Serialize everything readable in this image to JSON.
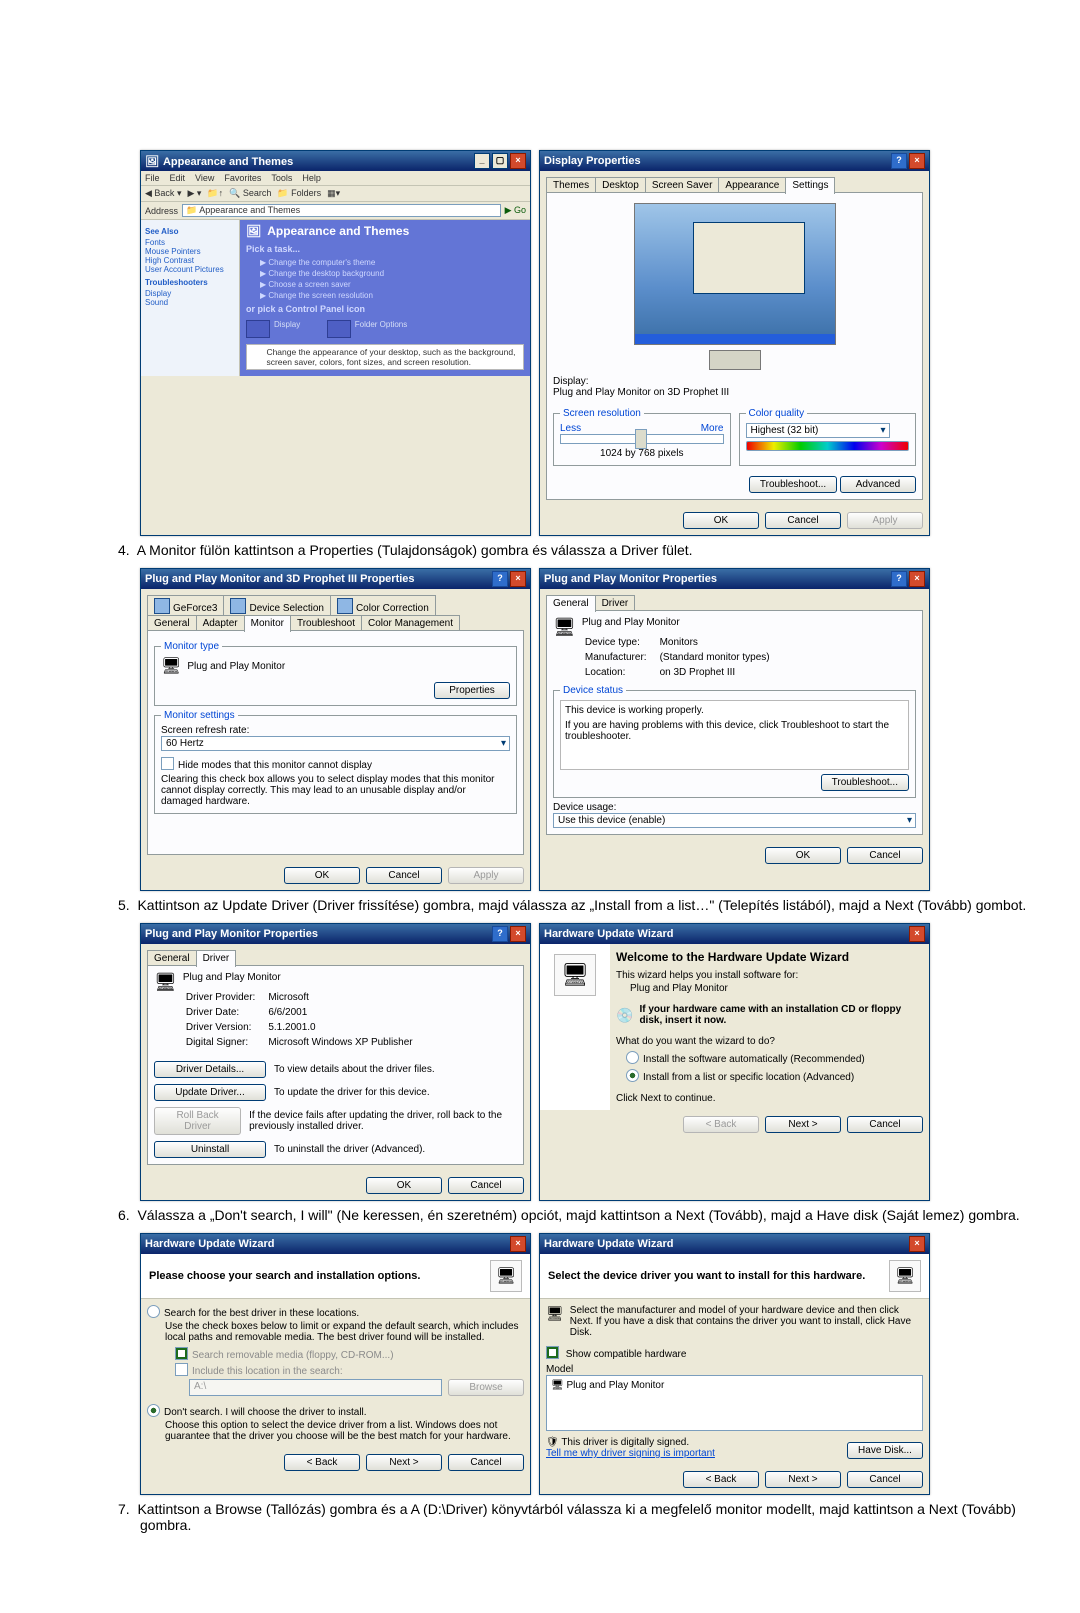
{
  "step4": {
    "num": "4.",
    "text": "A Monitor fülön kattintson a Properties (Tulajdonságok) gombra és válassza a Driver fület."
  },
  "step5": {
    "num": "5.",
    "text": "Kattintson az Update Driver (Driver frissítése) gombra, majd válassza az „Install from a list…\" (Telepítés listából), majd a Next (Tovább) gombot."
  },
  "step6": {
    "num": "6.",
    "text": "Válassza a „Don't search, I will\" (Ne keressen, én szeretném) opciót, majd kattintson a Next (Tovább), majd a Have disk (Saját lemez) gombra."
  },
  "step7": {
    "num": "7.",
    "text": "Kattintson a Browse (Tallózás) gombra és a A (D:\\Driver) könyvtárból válassza ki a megfelelő monitor modellt, majd kattintson a Next (Tovább) gombra."
  },
  "explorer": {
    "title": "Appearance and Themes",
    "menu": [
      "File",
      "Edit",
      "View",
      "Favorites",
      "Tools",
      "Help"
    ],
    "tb_back": "Back",
    "tb_search": "Search",
    "tb_folders": "Folders",
    "addr_lbl": "Address",
    "addr_val": "Appearance and Themes",
    "go": "Go",
    "side_seealso": "See Also",
    "side_links": [
      "Fonts",
      "Mouse Pointers",
      "High Contrast",
      "User Account Pictures"
    ],
    "side_trouble": "Troubleshooters",
    "side_tlinks": [
      "Display",
      "Sound"
    ],
    "cat": "Appearance and Themes",
    "pick": "Pick a task...",
    "tasks": [
      "Change the computer's theme",
      "Change the desktop background",
      "Choose a screen saver",
      "Change the screen resolution"
    ],
    "or": "or pick a Control Panel icon",
    "cpl_display": "Display",
    "cpl_folder": "Folder Options",
    "cpl_note": "Change the appearance of your desktop, such as the background, screen saver, colors, font sizes, and screen resolution."
  },
  "dispprops": {
    "title": "Display Properties",
    "tabs": [
      "Themes",
      "Desktop",
      "Screen Saver",
      "Appearance",
      "Settings"
    ],
    "tab_sel": "Settings",
    "display_lbl": "Display:",
    "display_val": "Plug and Play Monitor on 3D Prophet III",
    "res_lbl": "Screen resolution",
    "res_less": "Less",
    "res_more": "More",
    "res_val": "1024 by 768 pixels",
    "cq_lbl": "Color quality",
    "cq_val": "Highest (32 bit)",
    "btn_trouble": "Troubleshoot...",
    "btn_adv": "Advanced",
    "ok": "OK",
    "cancel": "Cancel",
    "apply": "Apply"
  },
  "pnp": {
    "title": "Plug and Play Monitor and 3D Prophet III Properties",
    "tabs_row1": [
      "GeForce3",
      "Device Selection",
      "Color Correction"
    ],
    "tabs_row2": [
      "General",
      "Adapter",
      "Monitor",
      "Troubleshoot",
      "Color Management"
    ],
    "tab_sel": "Monitor",
    "legend_type": "Monitor type",
    "mon": "Plug and Play Monitor",
    "btn_props": "Properties",
    "legend_set": "Monitor settings",
    "refresh_lbl": "Screen refresh rate:",
    "refresh_val": "60 Hertz",
    "hide_chk": "Hide modes that this monitor cannot display",
    "hide_desc": "Clearing this check box allows you to select display modes that this monitor cannot display correctly. This may lead to an unusable display and/or damaged hardware.",
    "ok": "OK",
    "cancel": "Cancel",
    "apply": "Apply"
  },
  "pnp_props": {
    "title": "Plug and Play Monitor Properties",
    "tabs": [
      "General",
      "Driver"
    ],
    "tab_sel": "General",
    "mon": "Plug and Play Monitor",
    "devtype_lbl": "Device type:",
    "devtype": "Monitors",
    "manu_lbl": "Manufacturer:",
    "manu": "(Standard monitor types)",
    "loc_lbl": "Location:",
    "loc": "on 3D Prophet III",
    "status_lbl": "Device status",
    "status_val": "This device is working properly.",
    "status_help": "If you are having problems with this device, click Troubleshoot to start the troubleshooter.",
    "btn_trouble": "Troubleshoot...",
    "usage_lbl": "Device usage:",
    "usage_val": "Use this device (enable)",
    "ok": "OK",
    "cancel": "Cancel"
  },
  "pnp_drv": {
    "title": "Plug and Play Monitor Properties",
    "tabs": [
      "General",
      "Driver"
    ],
    "tab_sel": "Driver",
    "mon": "Plug and Play Monitor",
    "prov_lbl": "Driver Provider:",
    "prov": "Microsoft",
    "date_lbl": "Driver Date:",
    "date": "6/6/2001",
    "ver_lbl": "Driver Version:",
    "ver": "5.1.2001.0",
    "sig_lbl": "Digital Signer:",
    "sig": "Microsoft Windows XP Publisher",
    "btn_details": "Driver Details...",
    "det_desc": "To view details about the driver files.",
    "btn_update": "Update Driver...",
    "upd_desc": "To update the driver for this device.",
    "btn_rollback": "Roll Back Driver",
    "roll_desc": "If the device fails after updating the driver, roll back to the previously installed driver.",
    "btn_uninstall": "Uninstall",
    "un_desc": "To uninstall the driver (Advanced).",
    "ok": "OK",
    "cancel": "Cancel"
  },
  "wiz1": {
    "title": "Hardware Update Wizard",
    "h": "Welcome to the Hardware Update Wizard",
    "intro": "This wizard helps you install software for:",
    "dev": "Plug and Play Monitor",
    "cd_hint": "If your hardware came with an installation CD or floppy disk, insert it now.",
    "what": "What do you want the wizard to do?",
    "opt_auto": "Install the software automatically (Recommended)",
    "opt_list": "Install from a list or specific location (Advanced)",
    "cont": "Click Next to continue.",
    "back": "< Back",
    "next": "Next >",
    "cancel": "Cancel"
  },
  "wiz2": {
    "title": "Hardware Update Wizard",
    "h": "Please choose your search and installation options.",
    "opt_search": "Search for the best driver in these locations.",
    "helptxt": "Use the check boxes below to limit or expand the default search, which includes local paths and removable media. The best driver found will be installed.",
    "chk_media": "Search removable media (floppy, CD-ROM...)",
    "chk_incl": "Include this location in the search:",
    "loc": "A:\\",
    "browse": "Browse",
    "opt_dont": "Don't search. I will choose the driver to install.",
    "dont_desc": "Choose this option to select the device driver from a list. Windows does not guarantee that the driver you choose will be the best match for your hardware.",
    "back": "< Back",
    "next": "Next >",
    "cancel": "Cancel"
  },
  "wiz3": {
    "title": "Hardware Update Wizard",
    "h": "Select the device driver you want to install for this hardware.",
    "help": "Select the manufacturer and model of your hardware device and then click Next. If you have a disk that contains the driver you want to install, click Have Disk.",
    "chk_compat": "Show compatible hardware",
    "model_lbl": "Model",
    "model": "Plug and Play Monitor",
    "signed": "This driver is digitally signed.",
    "tell": "Tell me why driver signing is important",
    "havedisk": "Have Disk...",
    "back": "< Back",
    "next": "Next >",
    "cancel": "Cancel"
  }
}
